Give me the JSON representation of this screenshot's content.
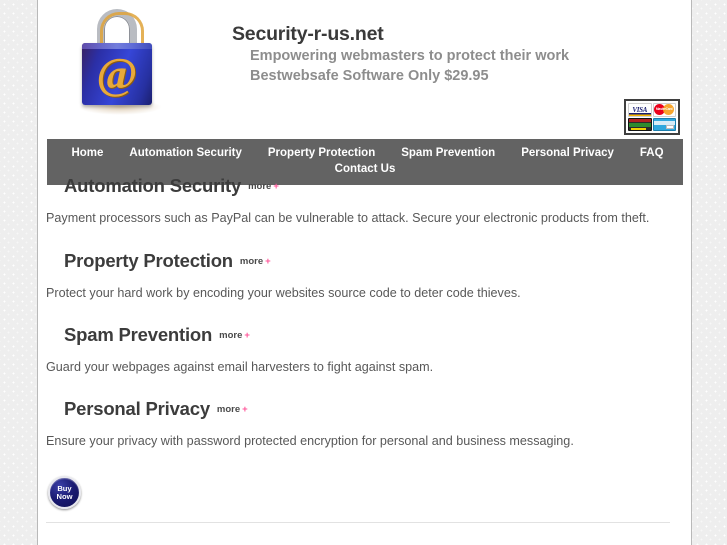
{
  "site": {
    "brand_title": "Security-r-us.net",
    "tagline_line1": "Empowering webmasters to protect their work",
    "tagline_line2": "Bestwebsafe Software Only $29.95",
    "logo_icon": "padlock-at-icon",
    "logo_glyph": "@"
  },
  "payment_badge": {
    "name": "accepted-cards-badge",
    "cards": [
      {
        "name": "visa",
        "label": "VISA"
      },
      {
        "name": "mastercard",
        "label": "MasterCard"
      },
      {
        "name": "discover-card",
        "label": ""
      },
      {
        "name": "american-express",
        "label": ""
      }
    ]
  },
  "nav": {
    "items": [
      {
        "label": "Home",
        "name": "nav-home"
      },
      {
        "label": "Automation Security",
        "name": "nav-automation-security"
      },
      {
        "label": "Property Protection",
        "name": "nav-property-protection"
      },
      {
        "label": "Spam Prevention",
        "name": "nav-spam-prevention"
      },
      {
        "label": "Personal Privacy",
        "name": "nav-personal-privacy"
      },
      {
        "label": "FAQ",
        "name": "nav-faq"
      },
      {
        "label": "Contact Us",
        "name": "nav-contact-us"
      }
    ]
  },
  "sections": [
    {
      "title": "Automation Security",
      "more_label": "more",
      "more_plus": "+",
      "body": "Payment processors such as PayPal can be vulnerable to attack. Secure your electronic products from theft."
    },
    {
      "title": "Property Protection",
      "more_label": "more",
      "more_plus": "+",
      "body": "Protect your hard work by encoding your websites source code to deter code thieves."
    },
    {
      "title": "Spam Prevention",
      "more_label": "more",
      "more_plus": "+",
      "body": "Guard your webpages against email harvesters to fight against spam."
    },
    {
      "title": "Personal Privacy",
      "more_label": "more",
      "more_plus": "+",
      "body": "Ensure your privacy with password protected encryption for personal and business messaging."
    }
  ],
  "buy_button": {
    "line1": "Buy",
    "line2": "Now"
  },
  "colors": {
    "nav_background": "#636363",
    "heading_text": "#3c3c3c",
    "body_text": "#585858",
    "tagline_text": "#8d8d8d",
    "plus_accent": "#ff5599",
    "buy_button": "#1b1b72",
    "page_background": "#ffffff"
  }
}
